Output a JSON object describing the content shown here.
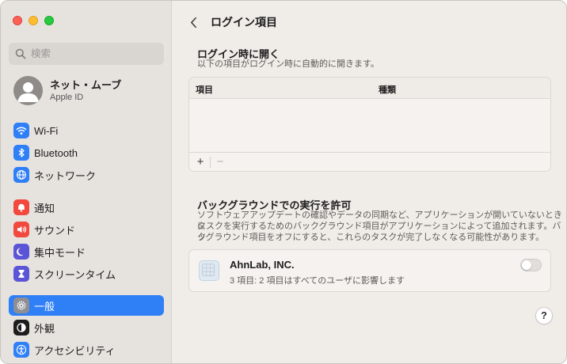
{
  "window": {
    "traffic_lights": [
      "close",
      "minimize",
      "maximize"
    ]
  },
  "sidebar": {
    "search_placeholder": "検索",
    "account": {
      "name": "ネット・ムーブ",
      "subtitle": "Apple ID"
    },
    "items": [
      {
        "label": "Wi-Fi",
        "icon": "wifi-icon",
        "color": "#2f7ff7"
      },
      {
        "label": "Bluetooth",
        "icon": "bluetooth-icon",
        "color": "#2f7ff7"
      },
      {
        "label": "ネットワーク",
        "icon": "globe-icon",
        "color": "#2f7ff7"
      },
      {
        "label": "通知",
        "icon": "bell-icon",
        "color": "#f2483e"
      },
      {
        "label": "サウンド",
        "icon": "speaker-icon",
        "color": "#f2483e"
      },
      {
        "label": "集中モード",
        "icon": "moon-icon",
        "color": "#5b54d6"
      },
      {
        "label": "スクリーンタイム",
        "icon": "hourglass-icon",
        "color": "#5b54d6"
      },
      {
        "label": "一般",
        "icon": "gear-icon",
        "color": "#8e8e93",
        "selected": true
      },
      {
        "label": "外観",
        "icon": "appearance-icon",
        "color": "#1d1d1d"
      },
      {
        "label": "アクセシビリティ",
        "icon": "accessibility-icon",
        "color": "#2f7ff7"
      }
    ]
  },
  "main": {
    "title": "ログイン項目",
    "login_section": {
      "title": "ログイン時に開く",
      "description": "以下の項目がログイン時に自動的に開きます。",
      "columns": [
        "項目",
        "種類"
      ],
      "add_label": "+",
      "remove_label": "−"
    },
    "background_section": {
      "title": "バックグラウンドでの実行を許可",
      "description_lines": [
        "ソフトウェアアップデートの確認やデータの同期など、アプリケーションが開いていないときに",
        "タスクを実行するためのバックグラウンド項目がアプリケーションによって追加されます。バッ",
        "クグラウンド項目をオフにすると、これらのタスクが完了しなくなる可能性があります。"
      ],
      "item": {
        "name": "AhnLab, INC.",
        "subtitle": "3 項目: 2 項目はすべてのユーザに影響します",
        "enabled": false
      }
    },
    "help_label": "?"
  }
}
